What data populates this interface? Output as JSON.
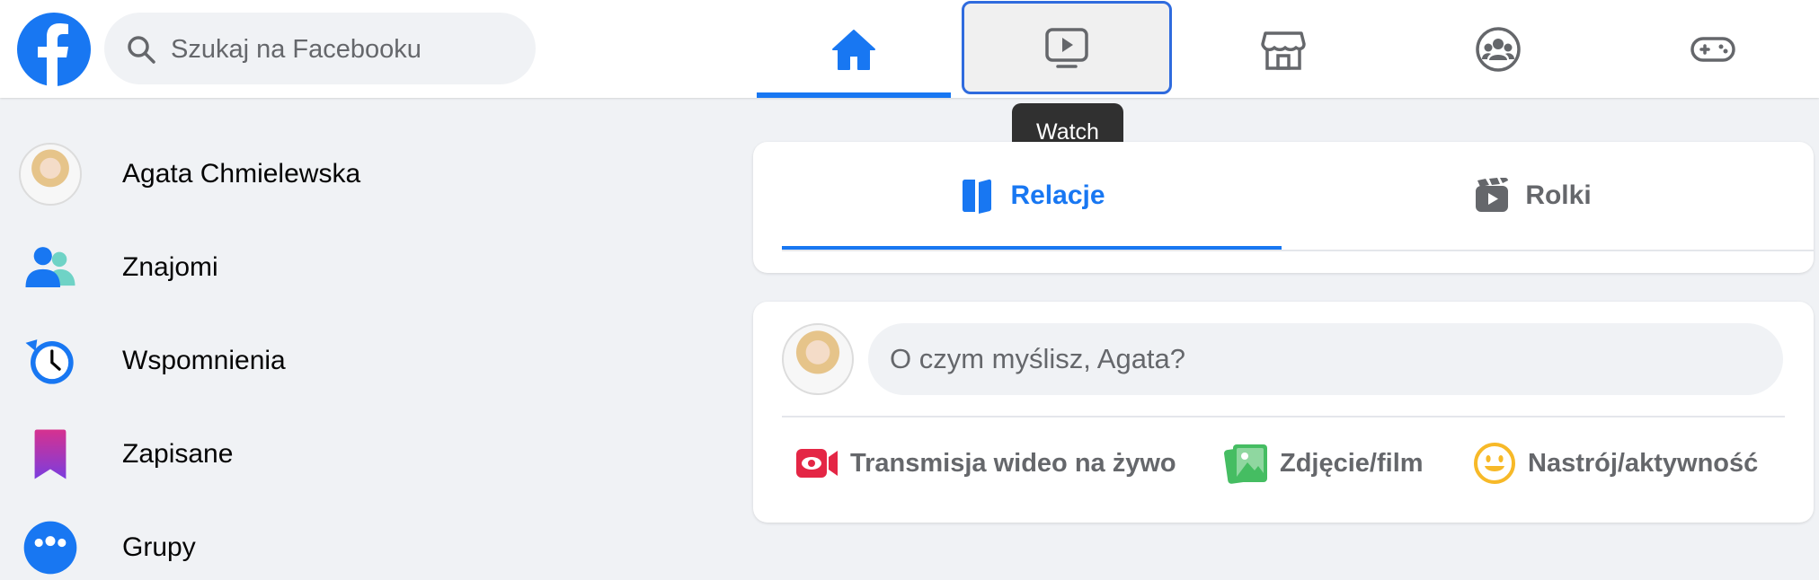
{
  "search": {
    "placeholder": "Szukaj na Facebooku"
  },
  "nav": {
    "tabs": [
      {
        "name": "home",
        "icon": "home-icon",
        "active": true
      },
      {
        "name": "watch",
        "icon": "video-icon",
        "hovered": true
      },
      {
        "name": "marketplace",
        "icon": "store-icon"
      },
      {
        "name": "groups",
        "icon": "groups-icon"
      },
      {
        "name": "gaming",
        "icon": "gamepad-icon"
      }
    ],
    "tooltip": "Watch"
  },
  "sidebar": {
    "items": [
      {
        "label": "Agata Chmielewska",
        "icon": "avatar"
      },
      {
        "label": "Znajomi",
        "icon": "friends-icon"
      },
      {
        "label": "Wspomnienia",
        "icon": "memories-icon"
      },
      {
        "label": "Zapisane",
        "icon": "bookmark-icon"
      },
      {
        "label": "Grupy",
        "icon": "groups-icon"
      }
    ]
  },
  "stories": {
    "tabs": [
      {
        "label": "Relacje",
        "active": true
      },
      {
        "label": "Rolki",
        "active": false
      }
    ]
  },
  "composer": {
    "placeholder": "O czym myślisz, Agata?",
    "actions": [
      {
        "label": "Transmisja wideo na żywo",
        "icon": "live-video-icon",
        "color": "#e42645"
      },
      {
        "label": "Zdjęcie/film",
        "icon": "photo-icon",
        "color": "#45bd62"
      },
      {
        "label": "Nastrój/aktywność",
        "icon": "feeling-icon",
        "color": "#f7b928"
      }
    ]
  },
  "colors": {
    "accent": "#1877f2",
    "background": "#f0f2f5",
    "icon_gray": "#65676b"
  }
}
